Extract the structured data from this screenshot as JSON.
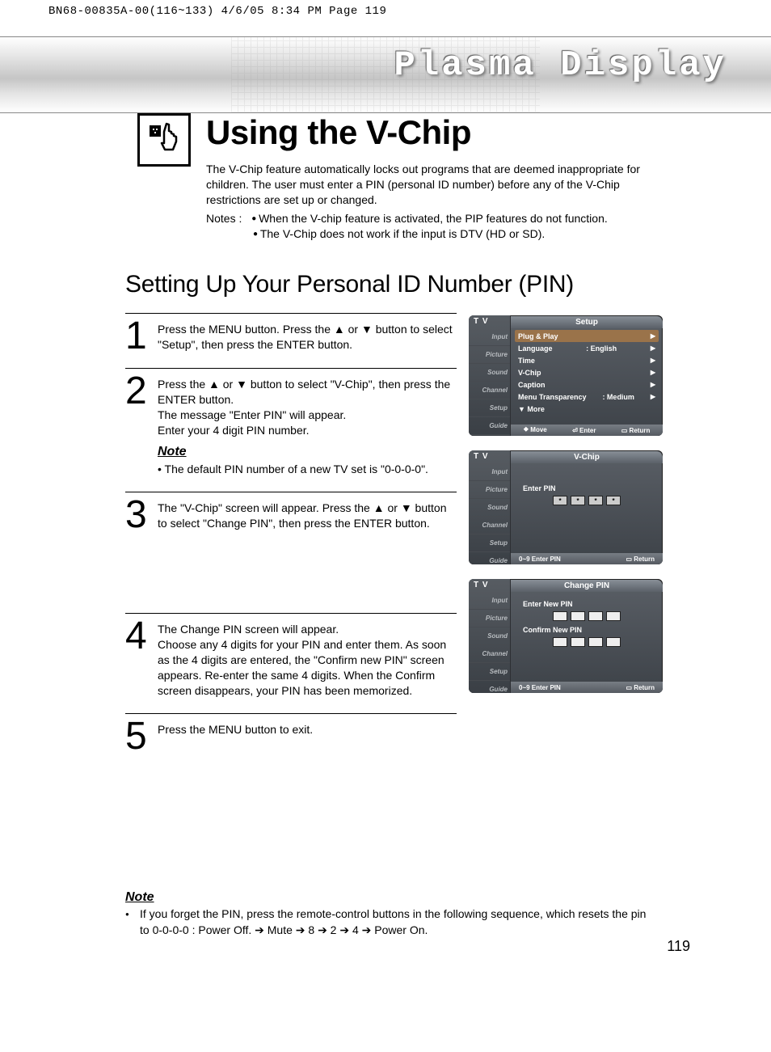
{
  "print_header": "BN68-00835A-00(116~133)  4/6/05  8:34 PM  Page 119",
  "brand": "Plasma Display",
  "page_title": "Using the V-Chip",
  "intro": {
    "p1": "The V-Chip feature automatically locks out programs that are deemed inappropriate for children. The user must enter a PIN (personal ID number) before any of the V-Chip restrictions are set up or changed.",
    "notes_label": "Notes :",
    "note1": "When the V-chip feature is activated, the PIP features do not function.",
    "note2": "The V-Chip does not work if the input is DTV (HD or SD)."
  },
  "section_title": "Setting Up Your Personal ID Number (PIN)",
  "steps": [
    {
      "num": "1",
      "text": "Press the MENU button. Press the ▲ or ▼ button to select \"Setup\", then press the ENTER button."
    },
    {
      "num": "2",
      "text": "Press the ▲ or ▼ button to select \"V-Chip\", then press the ENTER button.\nThe message \"Enter PIN\" will appear.\nEnter your 4 digit PIN number.",
      "note_label": "Note",
      "note": "The default PIN number of a new TV set is \"0-0-0-0\"."
    },
    {
      "num": "3",
      "text": "The \"V-Chip\" screen will appear. Press the ▲ or ▼ button to select \"Change PIN\", then press the ENTER button."
    },
    {
      "num": "4",
      "text": "The Change PIN screen will appear.\nChoose any 4 digits for your PIN and enter them. As soon as the 4 digits are entered, the \"Confirm new PIN\" screen appears. Re-enter the same 4 digits. When the Confirm screen disappears, your PIN has been memorized."
    },
    {
      "num": "5",
      "text": "Press the MENU button to exit."
    }
  ],
  "bottom_note": {
    "label": "Note",
    "text": "If you forget the PIN, press the remote-control buttons in the following sequence, which resets the pin to 0-0-0-0 : Power Off. ➔ Mute ➔ 8 ➔ 2 ➔ 4 ➔ Power On."
  },
  "page_number": "119",
  "osd_sidebar": [
    "Input",
    "Picture",
    "Sound",
    "Channel",
    "Setup",
    "Guide"
  ],
  "osd1": {
    "tv": "T V",
    "title": "Setup",
    "rows": [
      {
        "label": "Plug & Play",
        "value": "",
        "selected": true
      },
      {
        "label": "Language",
        "value": ": English"
      },
      {
        "label": "Time",
        "value": ""
      },
      {
        "label": "V-Chip",
        "value": ""
      },
      {
        "label": "Caption",
        "value": ""
      },
      {
        "label": "Menu Transparency",
        "value": ": Medium"
      },
      {
        "label": "▼ More",
        "value": "",
        "noarrow": true
      }
    ],
    "footer": [
      "⯁ Move",
      "⏎ Enter",
      "▭ Return"
    ]
  },
  "osd2": {
    "tv": "T V",
    "title": "V-Chip",
    "pin_label": "Enter PIN",
    "pin": [
      "*",
      "*",
      "*",
      "*"
    ],
    "footer": [
      "0~9 Enter PIN",
      "▭ Return"
    ]
  },
  "osd3": {
    "tv": "T V",
    "title": "Change PIN",
    "new_label": "Enter New PIN",
    "confirm_label": "Confirm New PIN",
    "footer": [
      "0~9 Enter PIN",
      "▭ Return"
    ]
  }
}
